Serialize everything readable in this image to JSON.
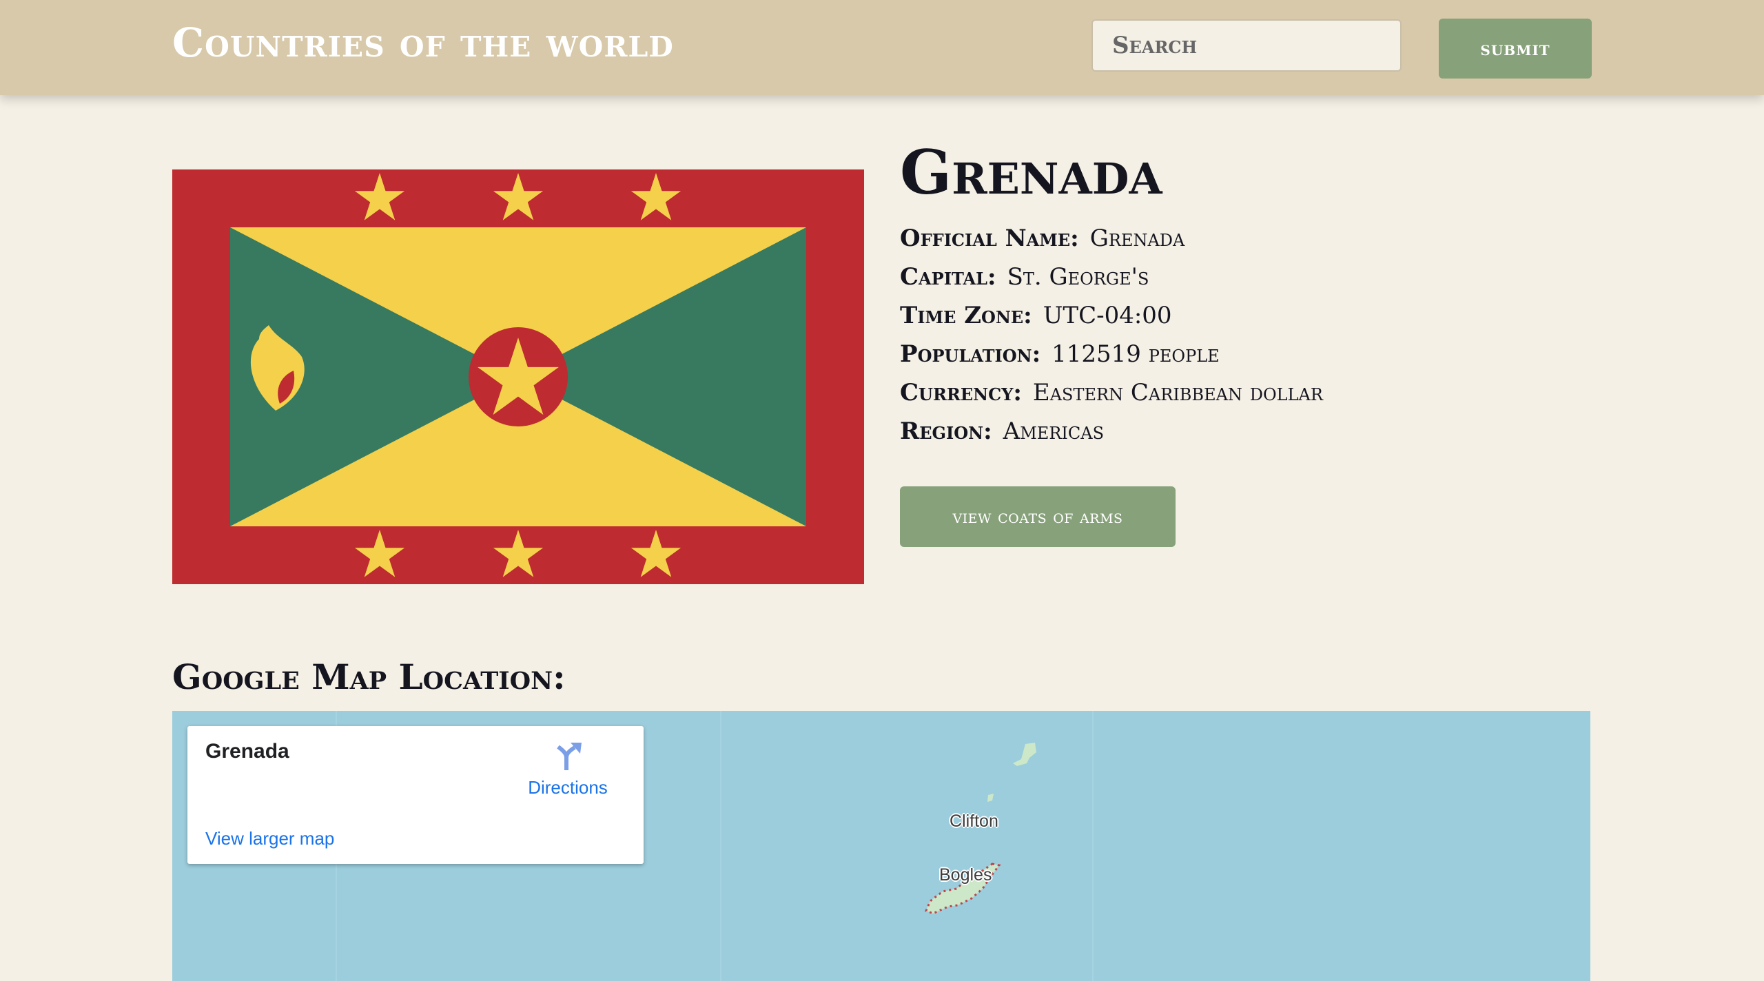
{
  "header": {
    "title": "Countries of the world",
    "search_placeholder": "Search",
    "submit_label": "submit"
  },
  "country": {
    "name": "Grenada",
    "info": [
      {
        "label": "Official Name:",
        "value": "Grenada"
      },
      {
        "label": "Capital:",
        "value": "St. George's"
      },
      {
        "label": "Time Zone:",
        "value": "UTC-04:00"
      },
      {
        "label": "Population:",
        "value": "112519 people"
      },
      {
        "label": "Currency:",
        "value": "Eastern Caribbean dollar"
      },
      {
        "label": "Region:",
        "value": "Americas"
      }
    ],
    "coats_button_label": "view coats of arms"
  },
  "flag": {
    "colors": {
      "red": "#be2b30",
      "yellow": "#f4d04b",
      "green": "#377a5f"
    }
  },
  "map_section": {
    "heading": "Google Map Location:",
    "card": {
      "place_name": "Grenada",
      "directions_label": "Directions",
      "larger_map_label": "View larger map"
    },
    "labels": {
      "clifton": "Clifton",
      "bogles": "Bogles"
    },
    "colors": {
      "water": "#9ccddd",
      "land": "#cde8c8",
      "link": "#1a73e8"
    }
  },
  "icons": {
    "directions": "directions-arrow-icon",
    "flag_star": "star-icon",
    "flag_nutmeg": "nutmeg-icon"
  }
}
